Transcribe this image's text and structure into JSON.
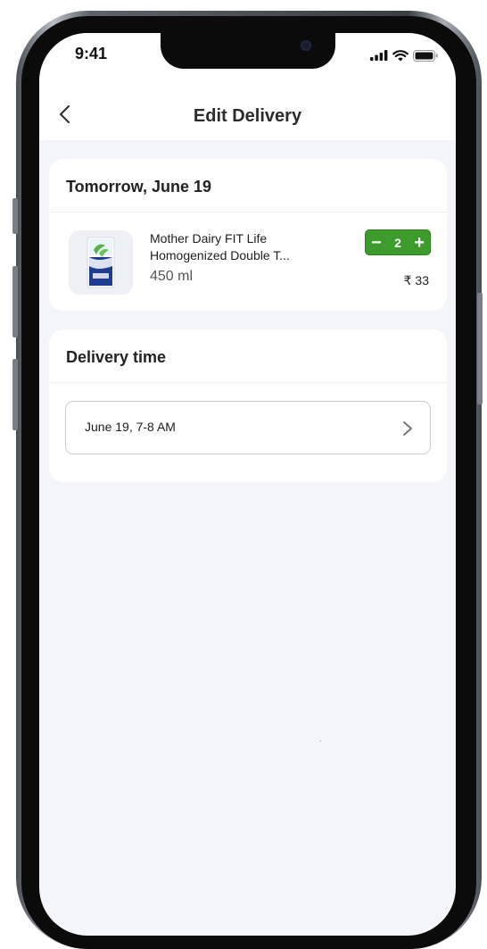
{
  "status_bar": {
    "time": "9:41",
    "icons": [
      "signal-icon",
      "wifi-icon",
      "battery-icon"
    ]
  },
  "header": {
    "title": "Edit Delivery",
    "back_icon": "chevron-left-icon"
  },
  "order_card": {
    "date_title": "Tomorrow, June 19",
    "item": {
      "name": "Mother Dairy FIT Life Homogenized Double T...",
      "size": "450 ml",
      "quantity": "2",
      "price": "₹ 33",
      "decrement_icon": "minus-icon",
      "increment_icon": "plus-icon"
    }
  },
  "delivery_card": {
    "title": "Delivery time",
    "selected_slot": "June 19, 7-8 AM",
    "chevron_icon": "chevron-right-icon"
  },
  "colors": {
    "accent_green": "#3d9a2c",
    "background": "#f4f5fa",
    "card": "#ffffff"
  }
}
